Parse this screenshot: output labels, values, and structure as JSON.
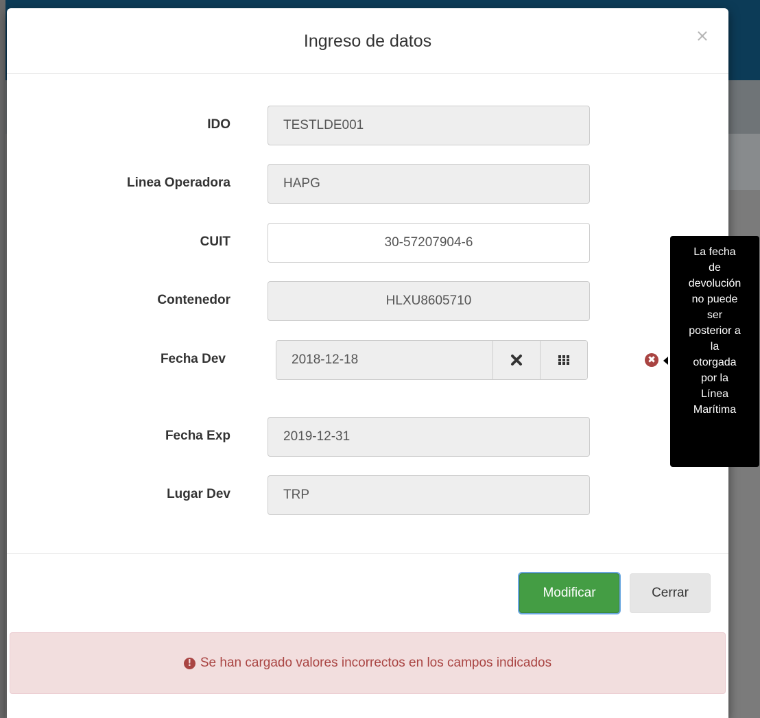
{
  "modal": {
    "title": "Ingreso de datos",
    "close_symbol": "×"
  },
  "fields": {
    "ido": {
      "label": "IDO",
      "value": "TESTLDE001"
    },
    "linea": {
      "label": "Linea Operadora",
      "value": "HAPG"
    },
    "cuit": {
      "label": "CUIT",
      "value": "30-57207904-6"
    },
    "contenedor": {
      "label": "Contenedor",
      "value": "HLXU8605710"
    },
    "fecha_dev": {
      "label": "Fecha Dev",
      "value": "2018-12-18",
      "clear_icon": "clear-icon",
      "calendar_icon": "calendar-icon"
    },
    "fecha_exp": {
      "label": "Fecha Exp",
      "value": "2019-12-31"
    },
    "lugar_dev": {
      "label": "Lugar Dev",
      "value": "TRP"
    }
  },
  "tooltip": {
    "lines": [
      "La fecha",
      "de",
      "devolución",
      "no puede",
      "ser",
      "posterior a",
      "la",
      "otorgada",
      "por la",
      "Línea",
      "Marítima"
    ]
  },
  "buttons": {
    "modify": "Modificar",
    "close": "Cerrar"
  },
  "alert": {
    "message": "Se han cargado valores incorrectos en los campos indicados"
  },
  "colors": {
    "success": "#449d44",
    "danger_text": "#a94442",
    "danger_bg": "#f2dede",
    "header_bg": "#0c3b57"
  }
}
